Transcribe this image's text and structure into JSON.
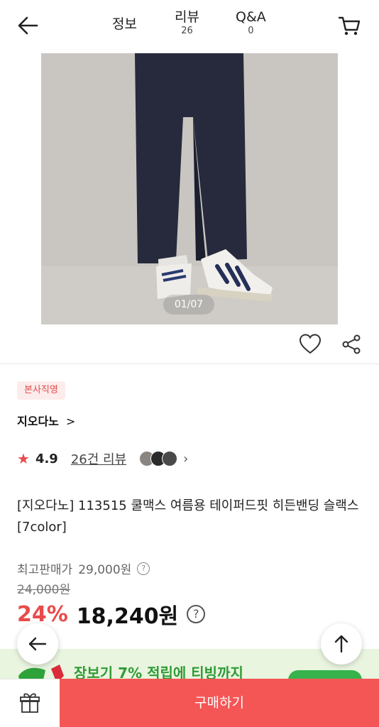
{
  "header": {
    "tabs": [
      {
        "label": "정보",
        "count": ""
      },
      {
        "label": "리뷰",
        "count": "26"
      },
      {
        "label": "Q&A",
        "count": "0"
      }
    ]
  },
  "gallery": {
    "counter": "01/07"
  },
  "product": {
    "badge": "본사직영",
    "brand": "지오다노",
    "brand_chevron": ">",
    "rating": "4.9",
    "review_link": "26건 리뷰",
    "swatch_colors": [
      "#8a8580",
      "#2a2a2a",
      "#4a4a4a"
    ],
    "title": "[지오다노] 113515 쿨맥스 여름용 테이퍼드핏 히든밴딩 슬랙스 [7color]",
    "max_price_label": "최고판매가",
    "max_price": "29,000원",
    "original_price": "24,000원",
    "discount": "24%",
    "final_price": "18,240원"
  },
  "banner": {
    "text": "장보기 7% 적립에 티빙까지"
  },
  "bottom": {
    "buy_label": "구매하기"
  },
  "colors": {
    "accent": "#f45555",
    "discount": "#e94b4b",
    "banner_green": "#2f9b35"
  }
}
